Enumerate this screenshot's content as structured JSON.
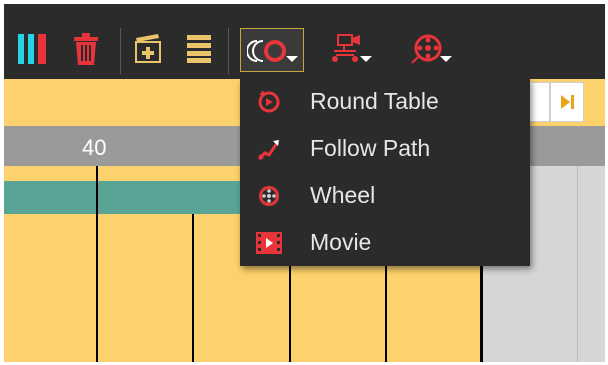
{
  "timeline": {
    "ruler_frame_label": "40"
  },
  "toolbar": {
    "buttons": [
      {
        "name": "color-bars-icon"
      },
      {
        "name": "trash-icon"
      },
      {
        "name": "add-keyframe-icon"
      },
      {
        "name": "layers-icon"
      },
      {
        "name": "round-table-tool-icon"
      },
      {
        "name": "follow-path-tool-icon"
      },
      {
        "name": "wheel-tool-icon"
      }
    ]
  },
  "menu": {
    "items": [
      {
        "label": "Round Table",
        "icon": "round-table-icon"
      },
      {
        "label": "Follow Path",
        "icon": "follow-path-icon"
      },
      {
        "label": "Wheel",
        "icon": "wheel-icon"
      },
      {
        "label": "Movie",
        "icon": "movie-icon"
      }
    ]
  },
  "colors": {
    "toolbar_bg": "#2b2b2b",
    "accent_red": "#e8343b",
    "accent_cyan": "#25d4e6",
    "accent_gold": "#c7a442",
    "timeline_yellow": "#fdd16b",
    "teal_track": "#5aa497"
  }
}
